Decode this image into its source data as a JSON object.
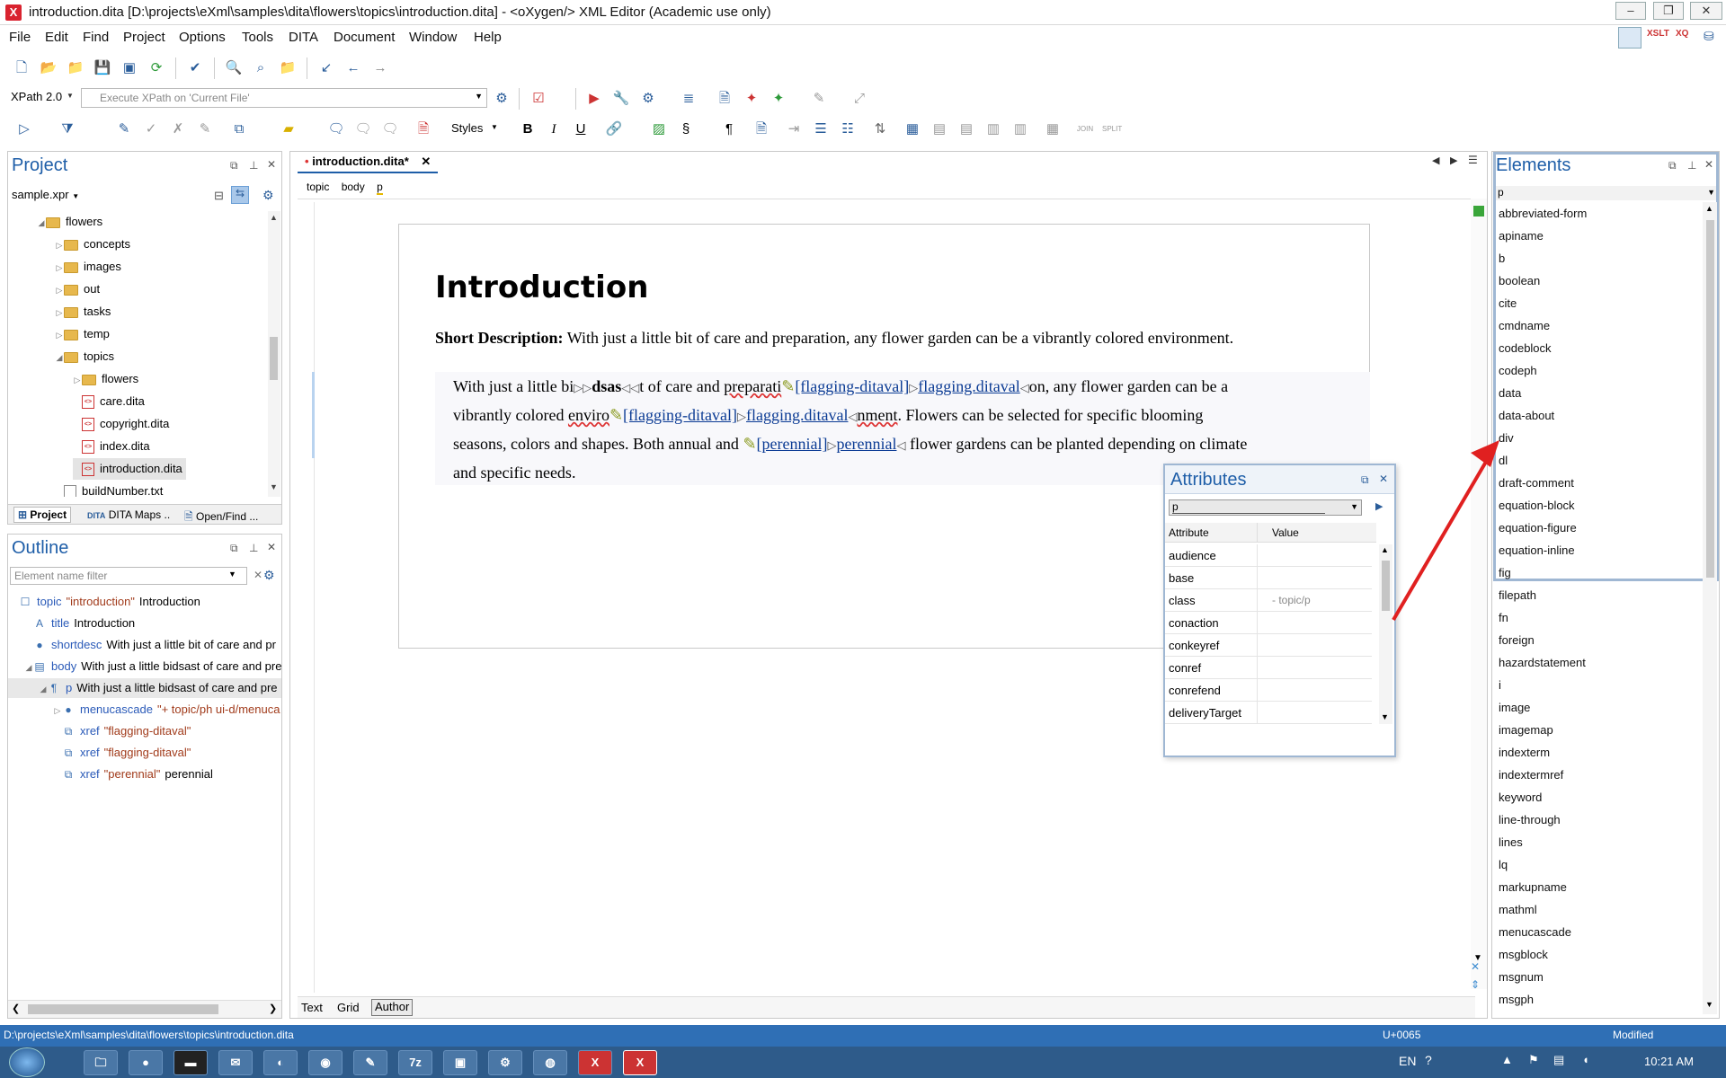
{
  "window": {
    "title": "introduction.dita [D:\\projects\\eXml\\samples\\dita\\flowers\\topics\\introduction.dita] - <oXygen/> XML Editor (Academic use only)"
  },
  "menu": [
    "File",
    "Edit",
    "Find",
    "Project",
    "Options",
    "Tools",
    "DITA",
    "Document",
    "Window",
    "Help"
  ],
  "xpath": {
    "version": "XPath 2.0",
    "placeholder": "Execute XPath on  'Current File'"
  },
  "styles_label": "Styles",
  "project": {
    "title": "Project",
    "file": "sample.xpr",
    "tree": [
      {
        "label": "flowers",
        "indent": 1,
        "type": "folder",
        "open": true
      },
      {
        "label": "concepts",
        "indent": 2,
        "type": "folder",
        "open": false
      },
      {
        "label": "images",
        "indent": 2,
        "type": "folder",
        "open": false
      },
      {
        "label": "out",
        "indent": 2,
        "type": "folder",
        "open": false
      },
      {
        "label": "tasks",
        "indent": 2,
        "type": "folder",
        "open": false
      },
      {
        "label": "temp",
        "indent": 2,
        "type": "folder",
        "open": false
      },
      {
        "label": "topics",
        "indent": 2,
        "type": "folder",
        "open": true
      },
      {
        "label": "flowers",
        "indent": 3,
        "type": "folder",
        "open": false
      },
      {
        "label": "care.dita",
        "indent": 3,
        "type": "file"
      },
      {
        "label": "copyright.dita",
        "indent": 3,
        "type": "file"
      },
      {
        "label": "index.dita",
        "indent": 3,
        "type": "file"
      },
      {
        "label": "introduction.dita",
        "indent": 3,
        "type": "file",
        "selected": true
      },
      {
        "label": "buildNumber.txt",
        "indent": 2,
        "type": "txt"
      }
    ],
    "tabs": [
      "Project",
      "DITA Maps ..",
      "Open/Find ..."
    ]
  },
  "outline": {
    "title": "Outline",
    "filter_placeholder": "Element name filter",
    "rows": [
      {
        "tag": "topic",
        "attr": "\"introduction\"",
        "text": "Introduction",
        "indent": 0
      },
      {
        "tag": "title",
        "attr": "",
        "text": "Introduction",
        "indent": 1
      },
      {
        "tag": "shortdesc",
        "attr": "",
        "text": "With just a little bit of care and pr",
        "indent": 1
      },
      {
        "tag": "body",
        "attr": "",
        "text": "With just a little bidsast of care and pre",
        "indent": 1
      },
      {
        "tag": "p",
        "attr": "",
        "text": "With just a little bidsast of care and pre",
        "indent": 2
      },
      {
        "tag": "menucascade",
        "attr": "\"+ topic/ph ui-d/menuca",
        "text": "",
        "indent": 3
      },
      {
        "tag": "xref",
        "attr": "\"flagging-ditaval\"",
        "text": "",
        "indent": 3
      },
      {
        "tag": "xref",
        "attr": "\"flagging-ditaval\"",
        "text": "",
        "indent": 3
      },
      {
        "tag": "xref",
        "attr": "\"perennial\"",
        "text": "perennial",
        "indent": 3
      }
    ]
  },
  "editor": {
    "tab": "introduction.dita*",
    "breadcrumb": [
      "topic",
      "body",
      "p"
    ],
    "heading": "Introduction",
    "shortdesc_label": "Short Description:",
    "shortdesc_text": "With just a little bit of care and preparation, any flower garden can be a vibrantly colored environment.",
    "para": {
      "t1": "With just a little bi",
      "t2": "dsas",
      "t3": "t of care and ",
      "t4": "preparati",
      "x1": "[flagging-ditaval]",
      "x2": "flagging.ditaval",
      "t5": "on, any flower garden can be a",
      "t6": "vibrantly colored ",
      "t7": "enviro",
      "x3": "[flagging-ditaval]",
      "x4": "flagging.ditaval",
      "t8": "nment",
      "t9": ". Flowers can be selected for specific blooming",
      "t10": "seasons, colors and shapes. Both annual and ",
      "x5": "[perennial]",
      "x6": "perennial",
      "t11": " flower gardens can be planted depending on climate",
      "t12": "and specific needs."
    },
    "bottom_tabs": [
      "Text",
      "Grid",
      "Author"
    ]
  },
  "attributes": {
    "title": "Attributes",
    "element": "p",
    "col_attr": "Attribute",
    "col_value": "Value",
    "rows": [
      {
        "name": "audience",
        "value": ""
      },
      {
        "name": "base",
        "value": ""
      },
      {
        "name": "class",
        "value": "- topic/p"
      },
      {
        "name": "conaction",
        "value": ""
      },
      {
        "name": "conkeyref",
        "value": ""
      },
      {
        "name": "conref",
        "value": ""
      },
      {
        "name": "conrefend",
        "value": ""
      },
      {
        "name": "deliveryTarget",
        "value": ""
      }
    ]
  },
  "elements": {
    "title": "Elements",
    "current": "p",
    "items": [
      "abbreviated-form",
      "apiname",
      "b",
      "boolean",
      "cite",
      "cmdname",
      "codeblock",
      "codeph",
      "data",
      "data-about",
      "div",
      "dl",
      "draft-comment",
      "equation-block",
      "equation-figure",
      "equation-inline",
      "fig",
      "filepath",
      "fn",
      "foreign",
      "hazardstatement",
      "i",
      "image",
      "imagemap",
      "indexterm",
      "indextermref",
      "keyword",
      "line-through",
      "lines",
      "lq",
      "markupname",
      "mathml",
      "menucascade",
      "msgblock",
      "msgnum",
      "msgph"
    ]
  },
  "statusbar": {
    "path": "D:\\projects\\eXml\\samples\\dita\\flowers\\topics\\introduction.dita",
    "unicode": "U+0065",
    "state": "Modified"
  },
  "taskbar": {
    "lang": "EN",
    "time": "10:21 AM"
  },
  "colors": {
    "accent": "#1e5ea8",
    "status_bar": "#2f6fb5",
    "arrow": "#e02020"
  }
}
